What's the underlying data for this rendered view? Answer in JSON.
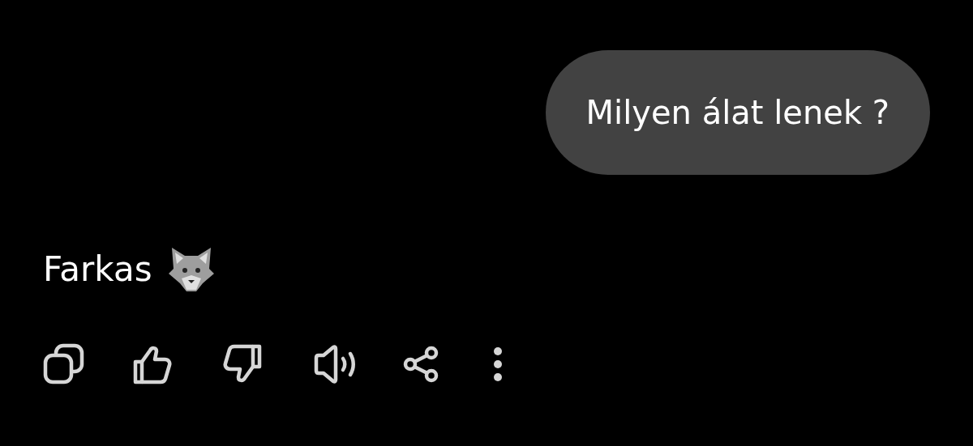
{
  "user_message": {
    "text": "Milyen álat lenek ?"
  },
  "reply": {
    "text": "Farkas"
  }
}
